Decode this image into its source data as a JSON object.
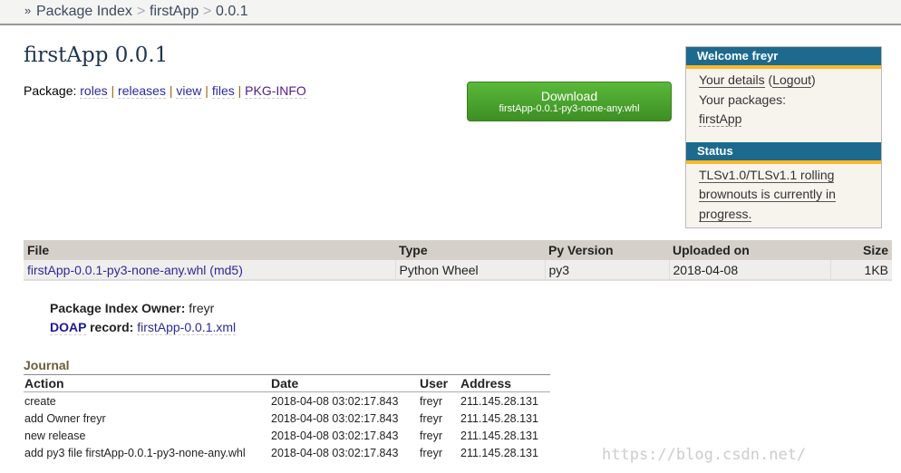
{
  "breadcrumb": {
    "marker": "»",
    "items": [
      "Package Index",
      "firstApp",
      "0.0.1"
    ],
    "sep": ">"
  },
  "title": "firstApp 0.0.1",
  "package_nav": {
    "label": "Package:",
    "links": [
      "roles",
      "releases",
      "view",
      "files",
      "PKG-INFO"
    ]
  },
  "download": {
    "label": "Download",
    "file": "firstApp-0.0.1-py3-none-any.whl",
    "color": "#4ea72e"
  },
  "sidebar": {
    "welcome_title": "Welcome freyr",
    "your_details": "Your details",
    "logout": "Logout",
    "your_packages": "Your packages:",
    "package": "firstApp",
    "status_title": "Status",
    "status_text": "TLSv1.0/TLSv1.1 rolling brownouts is currently in progress.",
    "header_color": "#1d6a8e",
    "accent": "#fbb829"
  },
  "files_table": {
    "headers": [
      "File",
      "Type",
      "Py Version",
      "Uploaded on",
      "Size"
    ],
    "rows": [
      {
        "file": "firstApp-0.0.1-py3-none-any.whl",
        "md5": "(md5)",
        "type": "Python Wheel",
        "py": "py3",
        "uploaded": "2018-04-08",
        "size": "1KB"
      }
    ]
  },
  "meta": {
    "owner_label": "Package Index Owner:",
    "owner": "freyr",
    "doap_label": "DOAP",
    "doap_suffix": "record:",
    "doap_file": "firstApp-0.0.1.xml"
  },
  "journal": {
    "title": "Journal",
    "headers": [
      "Action",
      "Date",
      "User",
      "Address"
    ],
    "rows": [
      [
        "create",
        "2018-04-08 03:02:17.843",
        "freyr",
        "211.145.28.131"
      ],
      [
        "add Owner freyr",
        "2018-04-08 03:02:17.843",
        "freyr",
        "211.145.28.131"
      ],
      [
        "new release",
        "2018-04-08 03:02:17.843",
        "freyr",
        "211.145.28.131"
      ],
      [
        "add py3 file firstApp-0.0.1-py3-none-any.whl",
        "2018-04-08 03:02:17.843",
        "freyr",
        "211.145.28.131"
      ]
    ]
  },
  "watermark": "https://blog.csdn.net/..."
}
